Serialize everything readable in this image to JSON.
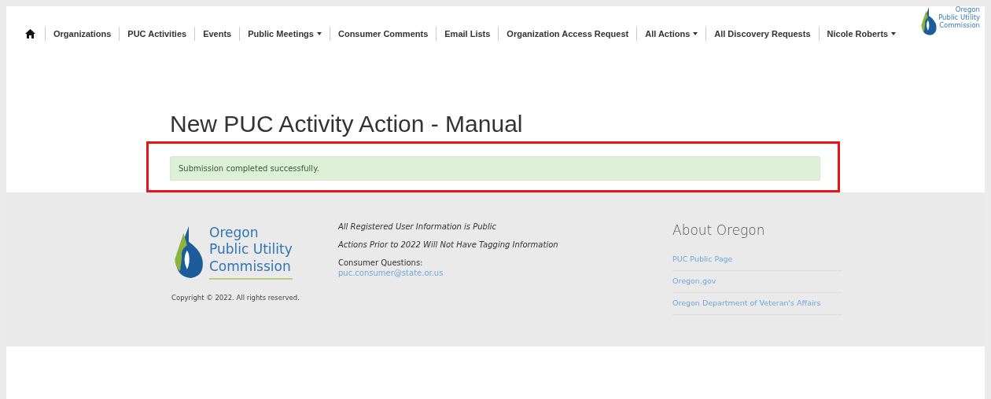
{
  "nav": {
    "home": {
      "kind": "home"
    },
    "items": [
      {
        "label": "Organizations",
        "kind": "link"
      },
      {
        "label": "PUC Activities",
        "kind": "link"
      },
      {
        "label": "Events",
        "kind": "link"
      },
      {
        "label": "Public Meetings",
        "kind": "dropdown"
      },
      {
        "label": "Consumer Comments",
        "kind": "link"
      },
      {
        "label": "Email Lists",
        "kind": "link"
      },
      {
        "label": "Organization Access Request",
        "kind": "link"
      },
      {
        "label": "All Actions",
        "kind": "dropdown"
      },
      {
        "label": "All Discovery Requests",
        "kind": "link"
      },
      {
        "label": "Nicole Roberts",
        "kind": "dropdown"
      }
    ],
    "logo_lines": [
      "Oregon",
      "Public Utility",
      "Commission"
    ]
  },
  "page_title": "New PUC Activity Action - Manual",
  "alert": {
    "text": "Submission completed successfully.",
    "highlighted": true
  },
  "footer": {
    "logo_lines": [
      "Oregon",
      "Public Utility",
      "Commission"
    ],
    "copyright": "Copyright © 2022. All rights reserved.",
    "notices": [
      "All Registered User Information is Public",
      "Actions Prior to 2022 Will Not Have Tagging Information"
    ],
    "contact_label": "Consumer Questions:",
    "contact_email": "puc.consumer@state.or.us",
    "links_title": "About Oregon",
    "links": [
      "PUC Public Page",
      "Oregon.gov",
      "Oregon Department of Veteran's Affairs"
    ]
  }
}
